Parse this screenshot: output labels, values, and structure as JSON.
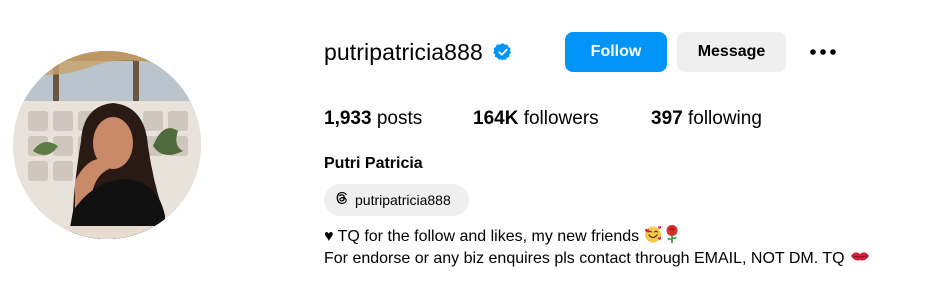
{
  "profile": {
    "username": "putripatricia888",
    "verified": true,
    "full_name": "Putri Patricia"
  },
  "actions": {
    "follow_label": "Follow",
    "message_label": "Message",
    "more_icon": "more-options-icon"
  },
  "stats": {
    "posts_count": "1,933",
    "posts_label": "posts",
    "followers_count": "164K",
    "followers_label": "followers",
    "following_count": "397",
    "following_label": "following"
  },
  "threads": {
    "icon": "threads-icon",
    "handle": "putripatricia888"
  },
  "bio": {
    "line1": "♥ TQ for the follow and likes, my new friends",
    "line1_emojis": [
      "smiling-face-with-hearts-emoji",
      "rose-emoji"
    ],
    "line2": "For endorse or any biz enquires pls contact through EMAIL, NOT DM. TQ",
    "line2_emojis": [
      "kiss-mark-emoji"
    ]
  },
  "colors": {
    "follow_button": "#0095f6",
    "secondary_button": "#efefef",
    "verified_badge": "#0095f6",
    "text": "#000000"
  }
}
